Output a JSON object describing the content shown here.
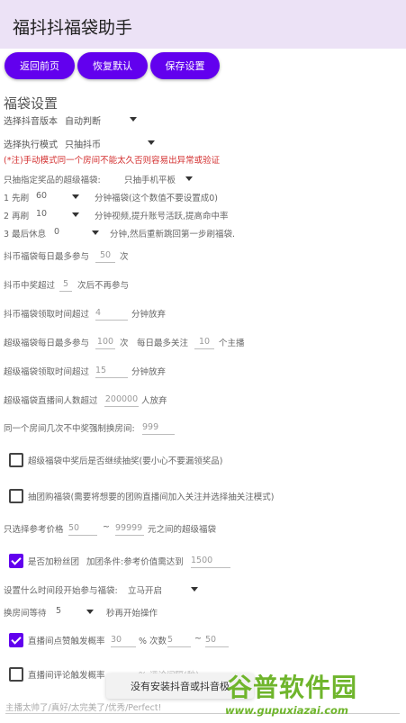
{
  "app": {
    "title": "福抖抖福袋助手"
  },
  "buttons": {
    "back": "返回前页",
    "reset": "恢复默认",
    "save": "保存设置"
  },
  "section_title": "福袋设置",
  "version": {
    "label": "选择抖音版本",
    "value": "自动判断"
  },
  "mode": {
    "label": "选择执行模式",
    "value": "只抽抖币"
  },
  "warning": "(*注)手动模式同一个房间不能太久否则容易出异常或验证",
  "super_prize": {
    "label": "只抽指定奖品的超级福袋:",
    "value": "只抽手机平板"
  },
  "step1": {
    "prefix": "1 先刷",
    "value": "60",
    "suffix": "分钟福袋(这个数值不要设置成0)"
  },
  "step2": {
    "prefix": "2 再刷",
    "value": "10",
    "suffix": "分钟视频,提升账号活跃,提高命中率"
  },
  "step3": {
    "prefix": "3 最后休息",
    "value": "0",
    "suffix": "分钟,然后重新跳回第一步刷福袋."
  },
  "coin_daily": {
    "label": "抖币福袋每日最多参与",
    "value": "50",
    "unit": "次"
  },
  "coin_win": {
    "label": "抖币中奖超过",
    "value": "5",
    "unit": "次后不再参与"
  },
  "coin_timeout": {
    "label": "抖币福袋领取时间超过",
    "value": "4",
    "unit": "分钟放弃"
  },
  "super_daily": {
    "label": "超级福袋每日最多参与",
    "value": "100",
    "unit": "次",
    "follow_label": "每日最多关注",
    "follow_value": "10",
    "follow_unit": "个主播"
  },
  "super_timeout": {
    "label": "超级福袋领取时间超过",
    "value": "15",
    "unit": "分钟放弃"
  },
  "super_viewers": {
    "label": "超级福袋直播间人数超过",
    "value": "200000",
    "unit": "人放弃"
  },
  "same_room": {
    "label": "同一个房间几次不中奖强制换房间:",
    "value": "999"
  },
  "continue_after_win": {
    "label": "超级福袋中奖后是否继续抽奖(要小心不要漏领奖品)",
    "checked": false
  },
  "group_buy": {
    "label": "抽团购福袋(需要将想要的团购直播间加入关注并选择抽关注模式)",
    "checked": false
  },
  "price_range": {
    "label": "只选择参考价格",
    "min": "50",
    "sep": "~",
    "max": "99999",
    "unit": "元之间的超级福袋"
  },
  "fan_club": {
    "label": "是否加粉丝团",
    "checked": true,
    "cond_label": "加团条件:参考价值需达到",
    "cond_value": "1500"
  },
  "start_time": {
    "label": "设置什么时间段开始参与福袋:",
    "value": "立马开启"
  },
  "room_wait": {
    "label": "换房间等待",
    "value": "5",
    "unit": "秒再开始操作"
  },
  "like": {
    "label": "直播间点赞触发概率",
    "checked": true,
    "rate": "30",
    "rate_unit": "% 次数",
    "min": "5",
    "sep": "~",
    "max": "50"
  },
  "comment": {
    "label": "直播间评论触发概率",
    "checked": false,
    "rate_unit": "% 评论间隔(秒)"
  },
  "comment_text": "主播太帅了/真好/太完美了/优秀/Perfect!",
  "toast": "没有安装抖音或抖音极",
  "watermark": {
    "title": "谷普软件园",
    "url": "www.gupuxiazai.com"
  }
}
